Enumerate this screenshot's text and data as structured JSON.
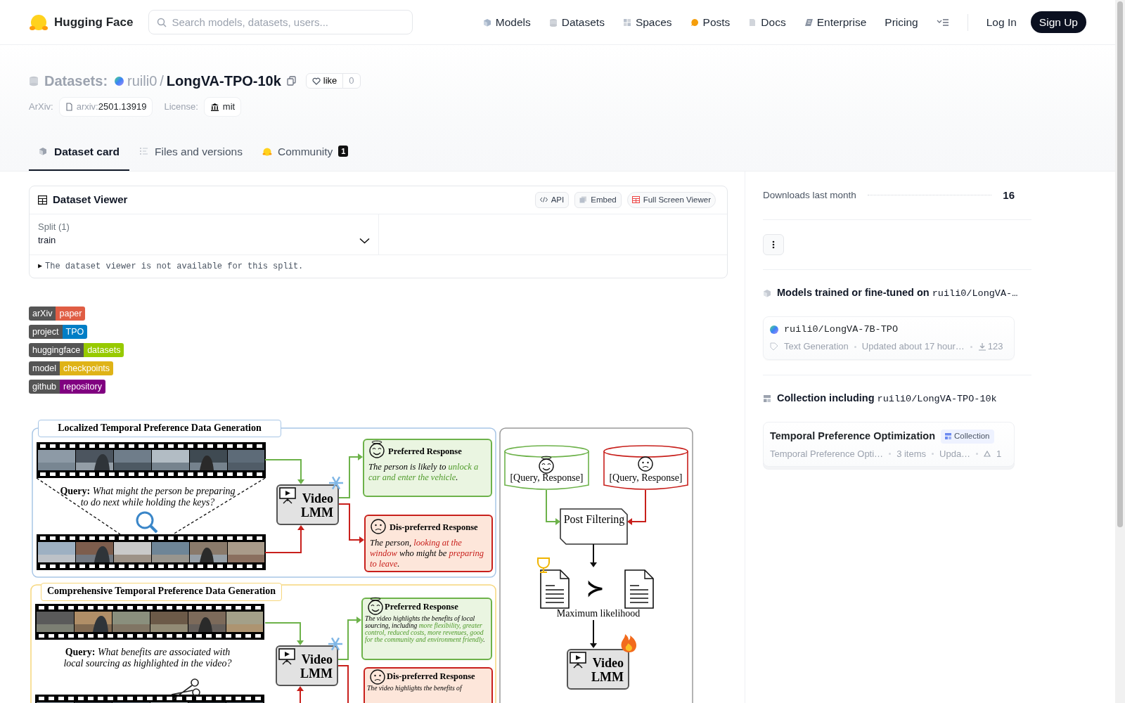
{
  "header": {
    "logo_text": "Hugging Face",
    "search": {
      "placeholder": "Search models, datasets, users..."
    },
    "nav": [
      {
        "label": "Models"
      },
      {
        "label": "Datasets"
      },
      {
        "label": "Spaces"
      },
      {
        "label": "Posts"
      },
      {
        "label": "Docs"
      },
      {
        "label": "Enterprise"
      },
      {
        "label": "Pricing"
      }
    ],
    "login": "Log In",
    "signup": "Sign Up"
  },
  "repo": {
    "type_label": "Datasets:",
    "owner": "ruili0",
    "separator": "/",
    "name": "LongVA-TPO-10k",
    "like": {
      "label": "like",
      "count": "0"
    },
    "arxiv": {
      "label": "ArXiv:",
      "prefix": "arxiv:",
      "id": "2501.13919"
    },
    "license": {
      "label": "License:",
      "value": "mit"
    }
  },
  "tabs": [
    {
      "label": "Dataset card",
      "selected": true
    },
    {
      "label": "Files and versions",
      "selected": false
    },
    {
      "label": "Community",
      "selected": false,
      "badge": "1"
    }
  ],
  "viewer": {
    "title": "Dataset Viewer",
    "buttons": [
      {
        "label": "API"
      },
      {
        "label": "Embed"
      },
      {
        "label": "Full Screen Viewer"
      }
    ],
    "split": {
      "label": "Split (1)",
      "value": "train"
    },
    "notice_marker": "▶",
    "notice": "The dataset viewer is not available for this split."
  },
  "badges": [
    {
      "label": "arXiv",
      "message": "paper",
      "color": "#e05d44"
    },
    {
      "label": "project",
      "message": "TPO",
      "color": "#007ec6"
    },
    {
      "label": "huggingface",
      "message": "datasets",
      "color": "#97ca00"
    },
    {
      "label": "model",
      "message": "checkpoints",
      "color": "#dfb317"
    },
    {
      "label": "github",
      "message": "repository",
      "color": "#800080"
    }
  ],
  "figure": {
    "sections": [
      {
        "color": "#a8c6e6",
        "title": "Localized Temporal Preference Data Generation",
        "query": "**Query:** *What might the person be preparing to do next while holding the keys?*",
        "model_label": "Video LMM",
        "responses": [
          {
            "kind": "preferred",
            "title": "Preferred Response",
            "segments": [
              {
                "text": "The person is likely to ",
                "highlight": false
              },
              {
                "text": "unlock a car and enter the vehicle",
                "highlight": true
              },
              {
                "text": ".",
                "highlight": false
              }
            ]
          },
          {
            "kind": "dispreferred",
            "title": "Dis-preferred Response",
            "segments": [
              {
                "text": "The person, ",
                "highlight": false
              },
              {
                "text": "looking at the window",
                "highlight": true
              },
              {
                "text": " who might be ",
                "highlight": false
              },
              {
                "text": "preparing to leave",
                "highlight": true
              },
              {
                "text": ".",
                "highlight": false
              }
            ]
          }
        ]
      },
      {
        "color": "#f6d67c",
        "title": "Comprehensive Temporal Preference Data Generation",
        "query": "**Query:** *What benefits are associated with local sourcing as highlighted in the video?*",
        "model_label": "Video LMM",
        "responses": [
          {
            "kind": "preferred",
            "title": "Preferred Response",
            "segments": [
              {
                "text": "The video highlights the benefits of local sourcing, including ",
                "highlight": false
              },
              {
                "text": "more flexibility, greater control, reduced costs, more revenues, good for the community and environment friendly",
                "highlight": true
              },
              {
                "text": ".",
                "highlight": false
              }
            ]
          },
          {
            "kind": "dispreferred",
            "title": "Dis-preferred Response",
            "segments": [
              {
                "text": "The video highlights the benefits of",
                "highlight": false
              }
            ]
          }
        ]
      }
    ],
    "training": {
      "stores": [
        {
          "kind": "preferred",
          "label": "[Query, Response]"
        },
        {
          "kind": "dispreferred",
          "label": "[Query, Response]"
        }
      ],
      "filter": "Post Filtering",
      "relation": "≻",
      "objective": "Maximum likelihood",
      "model_label": "Video LMM"
    }
  },
  "sidebar": {
    "downloads": {
      "label": "Downloads last month",
      "value": "16"
    },
    "models_heading": {
      "text": "Models trained or fine-tuned on",
      "repo": "ruili0/LongVA-…"
    },
    "models": [
      {
        "name": "ruili0/LongVA-7B-TPO",
        "task": "Text Generation",
        "updated": "Updated about 17 hour…",
        "downloads": "123"
      }
    ],
    "collection_heading": {
      "text": "Collection including",
      "repo": "ruili0/LongVA-TPO-10k"
    },
    "collections": [
      {
        "title": "Temporal Preference Optimization",
        "badge": "Collection",
        "description": "Temporal Preference Opti…",
        "items": "3 items",
        "updated": "Upda…",
        "upvotes": "1"
      }
    ]
  }
}
